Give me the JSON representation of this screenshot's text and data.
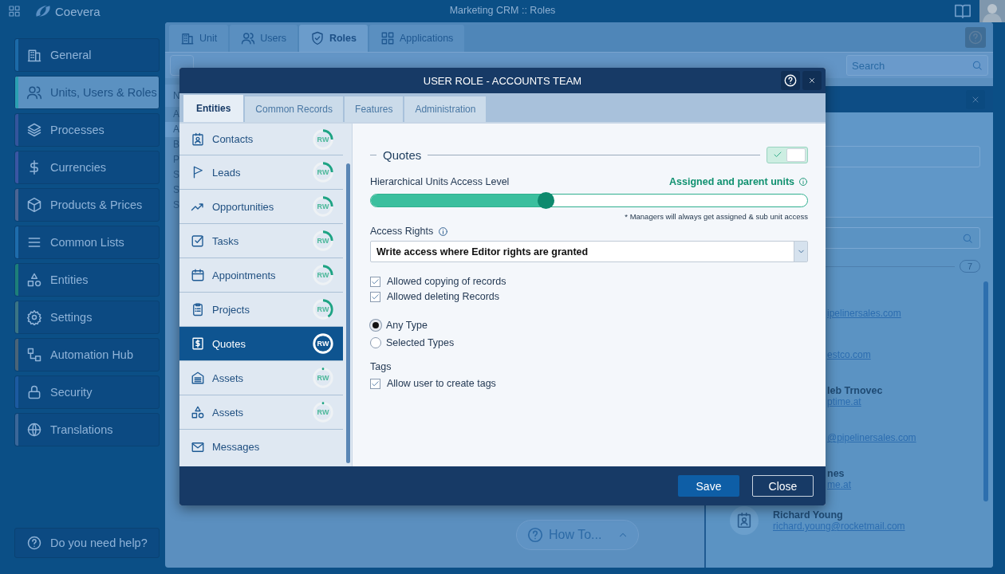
{
  "app": {
    "logo": "Coevera",
    "title": "Marketing CRM :: Roles"
  },
  "sidebar": {
    "items": [
      {
        "label": "General",
        "selected": false,
        "color": "#1c6aa8"
      },
      {
        "label": "Units, Users & Roles",
        "selected": true,
        "color": "#2a9fb3"
      },
      {
        "label": "Processes",
        "selected": false,
        "color": "#34559c"
      },
      {
        "label": "Currencies",
        "selected": false,
        "color": "#3a56a3"
      },
      {
        "label": "Products & Prices",
        "selected": false,
        "color": "#4b6594"
      },
      {
        "label": "Common Lists",
        "selected": false,
        "color": "#1e6cac"
      },
      {
        "label": "Entities",
        "selected": false,
        "color": "#1d7f79"
      },
      {
        "label": "Settings",
        "selected": false,
        "color": "#3a7585"
      },
      {
        "label": "Automation Hub",
        "selected": false,
        "color": "#4a6478"
      },
      {
        "label": "Security",
        "selected": false,
        "color": "#1c5aa0"
      },
      {
        "label": "Translations",
        "selected": false,
        "color": "#3b6799"
      }
    ],
    "help": "Do you need help?"
  },
  "tabs": [
    {
      "label": "Unit",
      "selected": false
    },
    {
      "label": "Users",
      "selected": false
    },
    {
      "label": "Roles",
      "selected": true
    },
    {
      "label": "Applications",
      "selected": false
    }
  ],
  "search": {
    "placeholder": "Search"
  },
  "list": {
    "header": "N",
    "rows": [
      {
        "text": "A",
        "selected": false
      },
      {
        "text": "A",
        "selected": true
      },
      {
        "text": "B",
        "selected": false
      },
      {
        "text": "P",
        "selected": false
      },
      {
        "text": "S",
        "selected": false
      },
      {
        "text": "S",
        "selected": false
      },
      {
        "text": "S",
        "selected": false
      }
    ]
  },
  "detail": {
    "badge": "7",
    "contacts": [
      {
        "email": "ipelinersales.com",
        "clipped": true
      },
      {
        "email": "estco.com",
        "clipped": true
      },
      {
        "name": "leb Trnovec",
        "email": "ptime.at",
        "clipped": true
      },
      {
        "email": "@pipelinersales.com",
        "clipped": true
      },
      {
        "name": "nes",
        "email": "me.at",
        "clipped": true
      },
      {
        "name": "Richard Young",
        "email": "richard.young@rocketmail.com",
        "clipped": false
      }
    ]
  },
  "how_to": "How To...",
  "dialog": {
    "title": "USER ROLE - ACCOUNTS TEAM",
    "tabs": [
      {
        "label": "Entities",
        "selected": true
      },
      {
        "label": "Common Records",
        "selected": false
      },
      {
        "label": "Features",
        "selected": false
      },
      {
        "label": "Administration",
        "selected": false
      }
    ],
    "entities": [
      {
        "label": "Contacts",
        "badge": "RW",
        "level": 0.25,
        "selected": false
      },
      {
        "label": "Leads",
        "badge": "RW",
        "level": 0.25,
        "selected": false
      },
      {
        "label": "Opportunities",
        "badge": "RW",
        "level": 0.25,
        "selected": false
      },
      {
        "label": "Tasks",
        "badge": "RW",
        "level": 0.25,
        "selected": false
      },
      {
        "label": "Appointments",
        "badge": "RW",
        "level": 0.25,
        "selected": false
      },
      {
        "label": "Projects",
        "badge": "RW",
        "level": 0.4,
        "selected": false
      },
      {
        "label": "Quotes",
        "badge": "RW",
        "level": 1,
        "selected": true
      },
      {
        "label": "Assets",
        "badge": "RW",
        "level": 0,
        "selected": false
      },
      {
        "label": "Assets",
        "badge": "RW",
        "level": 0,
        "selected": false
      },
      {
        "label": "Messages",
        "selected": false
      }
    ],
    "section": {
      "title": "Quotes",
      "enabled": true,
      "access_level": {
        "label": "Hierarchical Units Access Level",
        "value": "Assigned and parent units",
        "level": 0.4,
        "note": "* Managers will always get assigned & sub unit access"
      },
      "access_rights": {
        "label": "Access Rights",
        "value": "Write access where Editor rights are granted"
      },
      "permissions": [
        {
          "label": "Allowed copying of records",
          "checked": true
        },
        {
          "label": "Allowed deleting Records",
          "checked": true
        }
      ],
      "types": [
        {
          "label": "Any Type",
          "selected": true
        },
        {
          "label": "Selected Types",
          "selected": false
        }
      ],
      "tags": {
        "label": "Tags",
        "options": [
          {
            "label": "Allow user to create tags",
            "checked": true
          }
        ]
      }
    },
    "buttons": [
      {
        "label": "Save",
        "kind": "primary"
      },
      {
        "label": "Close",
        "kind": "secondary"
      }
    ]
  }
}
